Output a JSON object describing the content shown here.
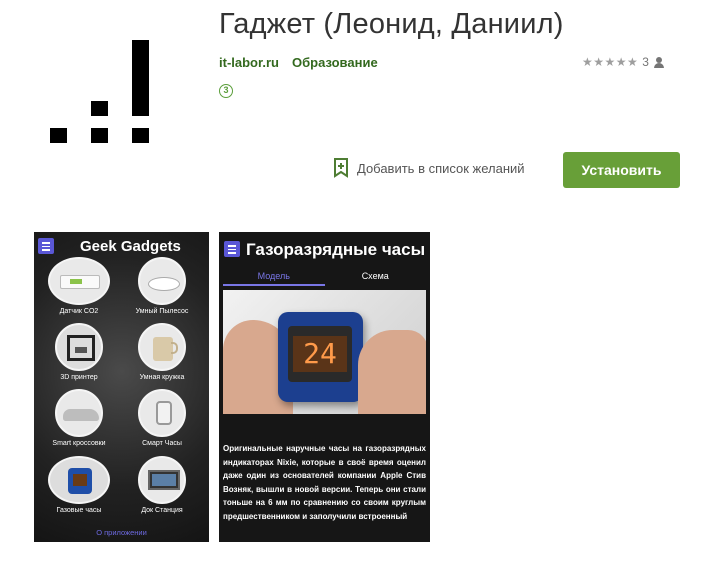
{
  "app": {
    "title": "Гаджет (Леонид, Даниил)",
    "developer": "it-labor.ru",
    "category": "Образование",
    "rating_count": "3",
    "rating_stars": "★★★★★",
    "age_rating": "3",
    "wishlist_label": "Добавить в список желаний",
    "install_label": "Установить"
  },
  "colors": {
    "accent_green": "#689f38",
    "link_green": "#33691e",
    "menu_purple": "#5a57d6"
  },
  "screenshot1": {
    "title": "Geek Gadgets",
    "items": [
      {
        "label": "Датчик CO2",
        "icon": "co2-sensor-icon"
      },
      {
        "label": "Умный Пылесос",
        "icon": "robot-vacuum-icon"
      },
      {
        "label": "3D принтер",
        "icon": "3d-printer-icon"
      },
      {
        "label": "Умная кружка",
        "icon": "smart-mug-icon"
      },
      {
        "label": "Smart кроссовки",
        "icon": "sneakers-icon"
      },
      {
        "label": "Смарт Часы",
        "icon": "smart-watch-icon"
      },
      {
        "label": "Газовые часы",
        "icon": "nixie-watch-icon"
      },
      {
        "label": "Док Станция",
        "icon": "dock-station-icon"
      }
    ],
    "about_label": "О приложении"
  },
  "screenshot2": {
    "title": "Газоразрядные часы",
    "tabs": [
      "Модель",
      "Схема"
    ],
    "watch_digits": "24",
    "description": "Оригинальные наручные часы на газоразрядных индикаторах Nixie, которые в своё время оценил даже один из основателей компании Apple Стив Возняк, вышли в новой версии. Теперь они стали тоньше на 6 мм по сравнению со своим круглым предшественником и заполучили встроенный"
  }
}
